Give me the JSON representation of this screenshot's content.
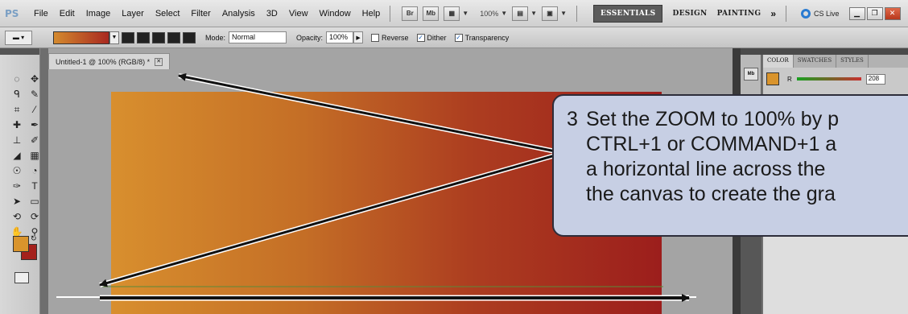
{
  "app": {
    "logo": "PS",
    "menu": [
      "File",
      "Edit",
      "Image",
      "Layer",
      "Select",
      "Filter",
      "Analysis",
      "3D",
      "View",
      "Window",
      "Help"
    ],
    "bridge_label": "Br",
    "minibridge_label": "Mb",
    "zoom_readout": "100%",
    "workspaces": [
      "ESSENTIALS",
      "DESIGN",
      "PAINTING"
    ],
    "more_label": "»",
    "cslive_label": "CS Live"
  },
  "options": {
    "mode_label": "Mode:",
    "mode_value": "Normal",
    "opacity_label": "Opacity:",
    "opacity_value": "100%",
    "reverse_label": "Reverse",
    "dither_label": "Dither",
    "transparency_label": "Transparency",
    "reverse_checked": false,
    "dither_checked": true,
    "transparency_checked": true
  },
  "document": {
    "tab_title": "Untitled-1 @ 100% (RGB/8) *"
  },
  "colors": {
    "foreground": "#d9942c",
    "background": "#a4201c",
    "gradient_start": "#d88f2e",
    "gradient_end": "#9c1e1c"
  },
  "panel": {
    "tabs": [
      "COLOR",
      "SWATCHES",
      "STYLES"
    ],
    "minibridge_label": "Mb",
    "channel_label": "R",
    "channel_value": "208"
  },
  "callout": {
    "number": "3",
    "lines": [
      "Set the ZOOM to 100% by p",
      "CTRL+1 or COMMAND+1 a",
      "a horizontal line across the",
      "the canvas to create the gra"
    ]
  }
}
